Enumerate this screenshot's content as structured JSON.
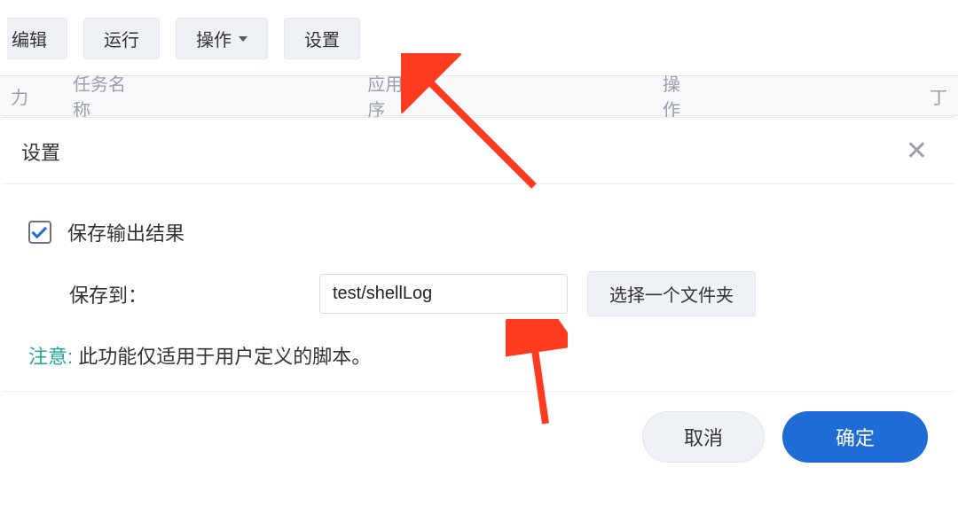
{
  "toolbar": {
    "edit": "编辑",
    "run": "运行",
    "actions": "操作",
    "settings": "设置"
  },
  "table_headers": {
    "enabled_col_partial": "力",
    "task_name": "任务名称",
    "application": "应用程序",
    "operate": "操作",
    "extra_right_edge": "丁"
  },
  "dialog": {
    "title": "设置",
    "checkbox_label": "保存输出结果",
    "save_to_label": "保存到：",
    "save_to_value": "test/shellLog",
    "choose_folder": "选择一个文件夹",
    "note_prefix": "注意:",
    "note_text": " 此功能仅适用于用户定义的脚本。",
    "cancel": "取消",
    "ok": "确定"
  }
}
